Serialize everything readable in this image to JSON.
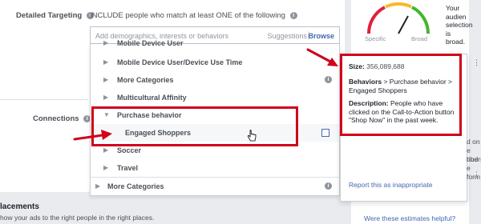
{
  "form": {
    "detailed_targeting_label": "Detailed Targeting",
    "include_text": "INCLUDE people who match at least ONE of the following",
    "connections_label": "Connections"
  },
  "search": {
    "placeholder": "Add demographics, interests or behaviors",
    "suggestions_label": "Suggestions",
    "browse_label": "Browse"
  },
  "dropdown": {
    "items": [
      {
        "label": "Mobile Device User"
      },
      {
        "label": "Mobile Device User/Device Use Time"
      },
      {
        "label": "More Categories"
      },
      {
        "label": "Multicultural Affinity"
      },
      {
        "label": "Purchase behavior"
      },
      {
        "label": "Engaged Shoppers"
      },
      {
        "label": "Soccer"
      },
      {
        "label": "Travel"
      },
      {
        "label": "More Categories"
      }
    ]
  },
  "tooltip": {
    "size_label": "Size:",
    "size_value": "356,089,688",
    "behaviors_label": "Behaviors",
    "behaviors_path": " > Purchase behavior > Engaged Shoppers",
    "description_label": "Description:",
    "description_text": " People who have clicked on the Call-to-Action button \"Shop Now\" in the past week.",
    "report_link": "Report this as inappropriate"
  },
  "audience": {
    "text_line1": "Your audien",
    "text_line2": "selection is",
    "text_line3": "broad.",
    "specific_label": "Specific",
    "broad_label": "Broad",
    "estimates_link": "Were these estimates helpful?"
  },
  "right_partial": {
    "line1": "d on",
    "line2": "e bud",
    "line3": "ribers",
    "line4": "e form"
  },
  "placements": {
    "title": "lacements",
    "description": "how your ads to the right people in the right places."
  },
  "colors": {
    "annotation_red": "#d0021b",
    "link_blue": "#4267b2",
    "gauge_red": "#e0203a",
    "gauge_yellow": "#f7b928",
    "gauge_green": "#42b72a"
  }
}
